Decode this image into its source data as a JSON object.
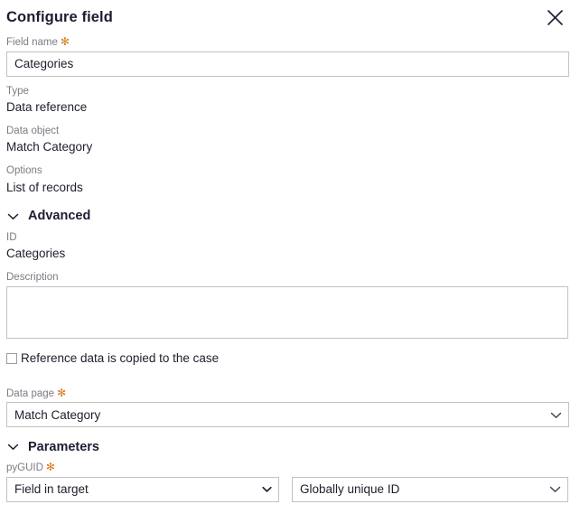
{
  "dialog": {
    "title": "Configure field",
    "close_icon": "close-icon"
  },
  "field_name": {
    "label": "Field name",
    "required": true,
    "required_marker": "✻",
    "value": "Categories",
    "placeholder": ""
  },
  "readonly_fields": [
    {
      "label": "Type",
      "value": "Data reference"
    },
    {
      "label": "Data object",
      "value": "Match Category"
    },
    {
      "label": "Options",
      "value": "List of records"
    }
  ],
  "advanced_section": {
    "title": "Advanced",
    "expanded": true,
    "chevron_icon": "chevron-down-icon",
    "id_field": {
      "label": "ID",
      "value": "Categories"
    },
    "description_field": {
      "label": "Description",
      "value": "",
      "placeholder": ""
    },
    "copy_checkbox": {
      "label": "Reference data is copied to the case",
      "checked": false
    },
    "data_page": {
      "label": "Data page",
      "required": true,
      "required_marker": "✻",
      "value": "Match Category",
      "chevron_icon": "chevron-down-icon"
    }
  },
  "parameters_section": {
    "title": "Parameters",
    "expanded": true,
    "chevron_icon": "chevron-down-icon",
    "pyguid": {
      "label": "pyGUID",
      "required": true,
      "required_marker": "✻",
      "source_select": {
        "value": "Field in target",
        "chevron_icon": "chevron-down-icon"
      },
      "target_select": {
        "value": "Globally unique ID",
        "chevron_icon": "chevron-down-icon"
      }
    }
  },
  "colors": {
    "title_text": "#1d1d33",
    "label_text": "#7b7b85",
    "value_text": "#20202e",
    "required_star": "#d97817",
    "border": "#c2c2c2",
    "background": "#ffffff"
  }
}
